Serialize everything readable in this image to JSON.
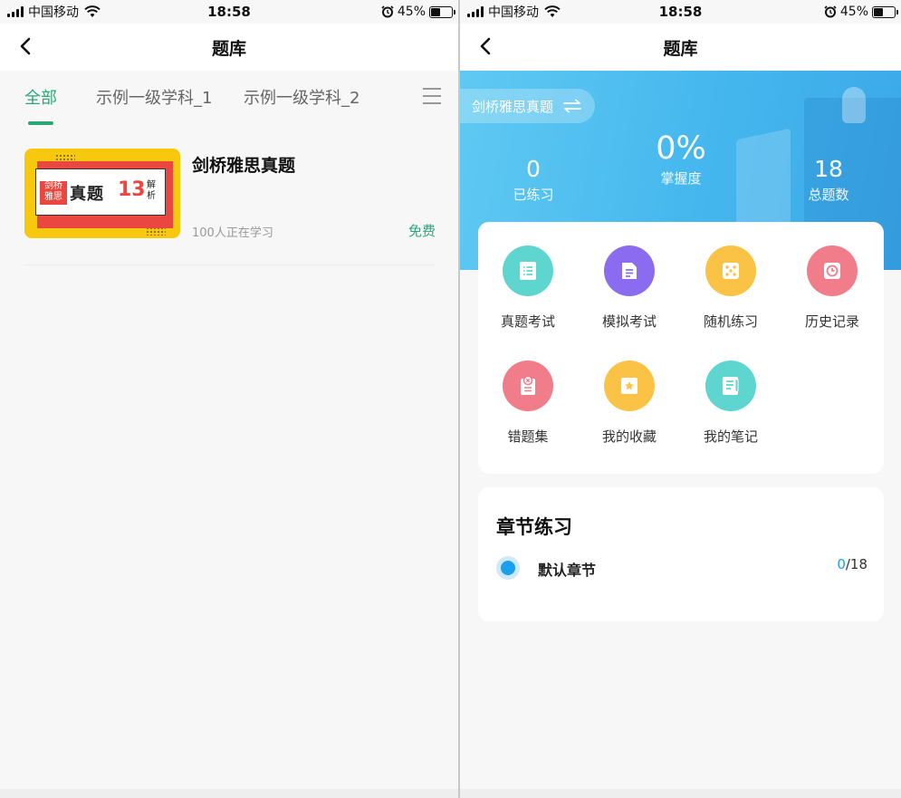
{
  "status_bar": {
    "carrier": "中国移动",
    "time": "18:58",
    "battery": "45%"
  },
  "left": {
    "nav_title": "题库",
    "tabs": [
      "全部",
      "示例一级学科_1",
      "示例一级学科_2"
    ],
    "active_tab": "全部",
    "course": {
      "title": "剑桥雅思真题",
      "learners": "100人正在学习",
      "price": "免费",
      "thumbnail": {
        "seal_line1": "剑桥",
        "seal_line2": "雅思",
        "big_text": "真题",
        "number": "13",
        "side_line1": "解",
        "side_line2": "析"
      }
    }
  },
  "right": {
    "nav_title": "题库",
    "subject": "剑桥雅思真题",
    "stats": {
      "practiced_value": "0",
      "practiced_label": "已练习",
      "mastery_value": "0%",
      "mastery_label": "掌握度",
      "total_value": "18",
      "total_label": "总题数"
    },
    "functions": [
      {
        "label": "真题考试",
        "icon": "list-icon",
        "color": "#5ed6cf"
      },
      {
        "label": "模拟考试",
        "icon": "document-icon",
        "color": "#8b6cf0"
      },
      {
        "label": "随机练习",
        "icon": "dice-icon",
        "color": "#fbc346"
      },
      {
        "label": "历史记录",
        "icon": "clock-icon",
        "color": "#f27d8a"
      },
      {
        "label": "错题集",
        "icon": "wrong-icon",
        "color": "#f27d8a"
      },
      {
        "label": "我的收藏",
        "icon": "star-icon",
        "color": "#fbc346"
      },
      {
        "label": "我的笔记",
        "icon": "note-icon",
        "color": "#5ed6cf"
      }
    ],
    "chapters": {
      "title": "章节练习",
      "items": [
        {
          "name": "默认章节",
          "done": "0",
          "total": "/18"
        }
      ]
    }
  },
  "colors": {
    "accent_green": "#2aa777",
    "accent_blue": "#1aa0ec",
    "hero_blue": "#45b7ee"
  }
}
